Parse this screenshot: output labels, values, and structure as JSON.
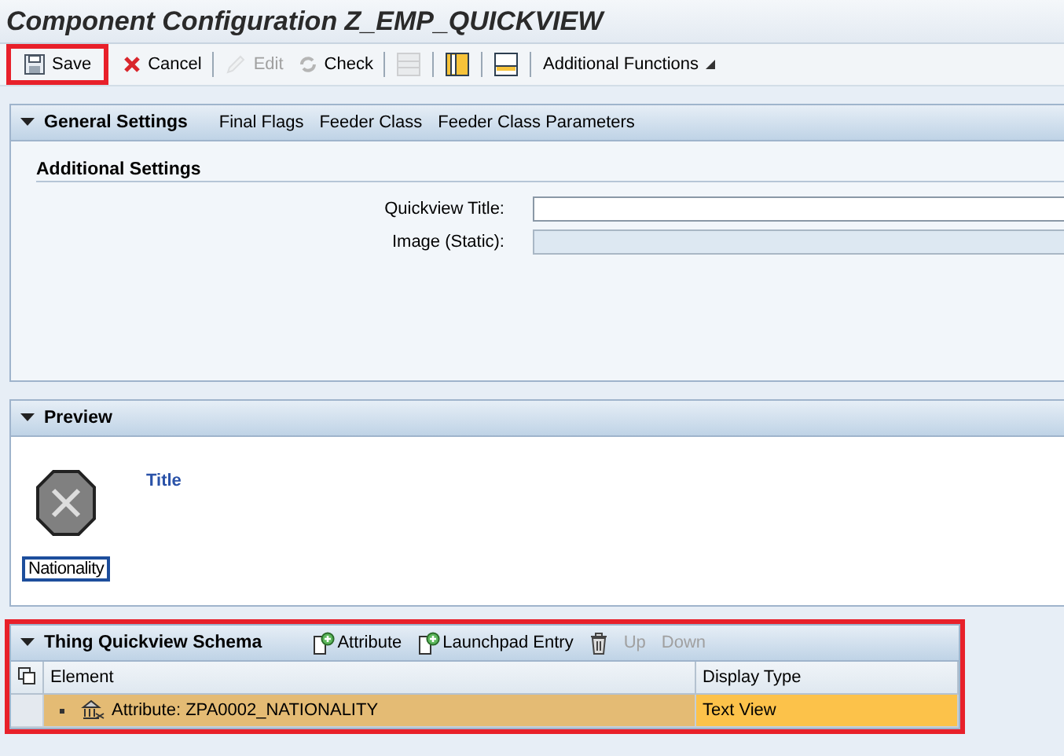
{
  "window": {
    "title": "Component Configuration Z_EMP_QUICKVIEW"
  },
  "toolbar": [
    {
      "kind": "save",
      "label": "Save",
      "disabled": false,
      "highlighted": true
    },
    {
      "kind": "cancel",
      "label": "Cancel",
      "disabled": false,
      "highlighted": false
    },
    {
      "kind": "separator"
    },
    {
      "kind": "edit",
      "label": "Edit",
      "disabled": true,
      "highlighted": false
    },
    {
      "kind": "check",
      "label": "Check",
      "disabled": false,
      "highlighted": false
    },
    {
      "kind": "separator"
    },
    {
      "kind": "view-single",
      "disabled": true,
      "highlighted": false
    },
    {
      "kind": "separator"
    },
    {
      "kind": "view-columns",
      "disabled": false,
      "highlighted": false
    },
    {
      "kind": "separator"
    },
    {
      "kind": "view-rows",
      "disabled": false,
      "highlighted": false
    },
    {
      "kind": "separator"
    },
    {
      "kind": "menu",
      "label": "Additional Functions",
      "disabled": false,
      "highlighted": false
    }
  ],
  "general_settings": {
    "title": "General Settings",
    "expanded": true,
    "links": [
      "Final Flags",
      "Feeder Class",
      "Feeder Class Parameters"
    ],
    "group_title": "Additional Settings",
    "fields": [
      {
        "label": "Quickview Title:",
        "disabled": false
      },
      {
        "label": "Image (Static):",
        "disabled": true
      }
    ]
  },
  "preview": {
    "title": "Preview",
    "expanded": true,
    "image_label": "Nationality",
    "image_label_focused": true,
    "heading": "Title"
  },
  "schema": {
    "title": "Thing Quickview Schema",
    "expanded": true,
    "highlighted": true,
    "actions": [
      {
        "kind": "add",
        "label": "Attribute",
        "disabled": false
      },
      {
        "kind": "add",
        "label": "Launchpad Entry",
        "disabled": false
      },
      {
        "kind": "delete",
        "disabled": false
      },
      {
        "kind": "text",
        "label": "Up",
        "disabled": true
      },
      {
        "kind": "text",
        "label": "Down",
        "disabled": true
      }
    ],
    "columns": [
      "Element",
      "Display Type"
    ],
    "rows": [
      {
        "element": "Attribute: ZPA0002_NATIONALITY",
        "display_type": "Text View",
        "selected": true
      }
    ]
  }
}
